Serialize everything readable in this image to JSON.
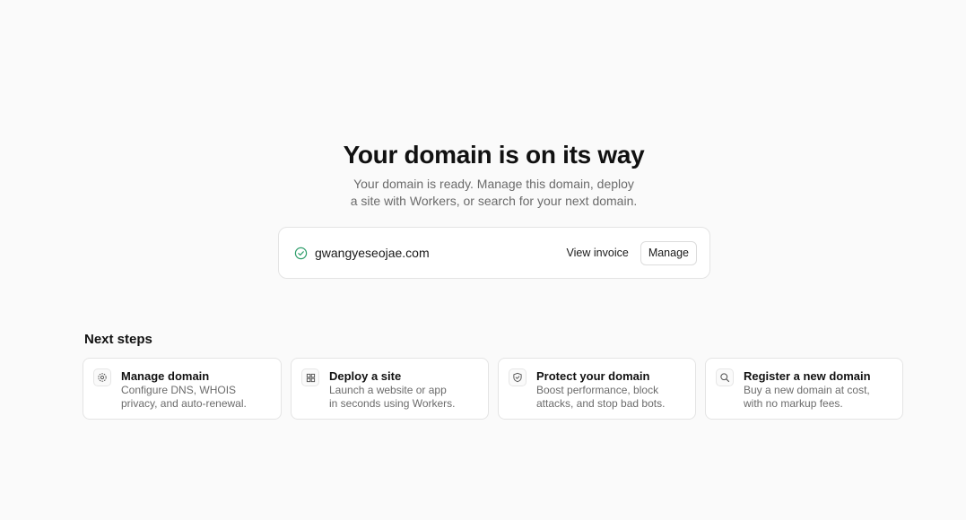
{
  "hero": {
    "title": "Your domain is on its way",
    "subtitle": "Your domain is ready. Manage this domain, deploy a site with Workers, or search for your next domain."
  },
  "domain": {
    "name": "gwangyeseojae.com",
    "status_icon": "check-circle-icon",
    "view_invoice_label": "View invoice",
    "manage_label": "Manage",
    "status_color": "#2f9e6b"
  },
  "next_steps": {
    "title": "Next steps",
    "items": [
      {
        "icon": "gear-icon",
        "title": "Manage domain",
        "description": "Configure DNS, WHOIS\nprivacy, and auto-renewal."
      },
      {
        "icon": "grid-icon",
        "title": "Deploy a site",
        "description": "Launch a website or app\nin seconds using Workers."
      },
      {
        "icon": "shield-icon",
        "title": "Protect your domain",
        "description": "Boost performance, block\nattacks, and stop bad bots."
      },
      {
        "icon": "search-icon",
        "title": "Register a new domain",
        "description": "Buy a new domain at cost,\nwith no markup fees."
      }
    ]
  }
}
